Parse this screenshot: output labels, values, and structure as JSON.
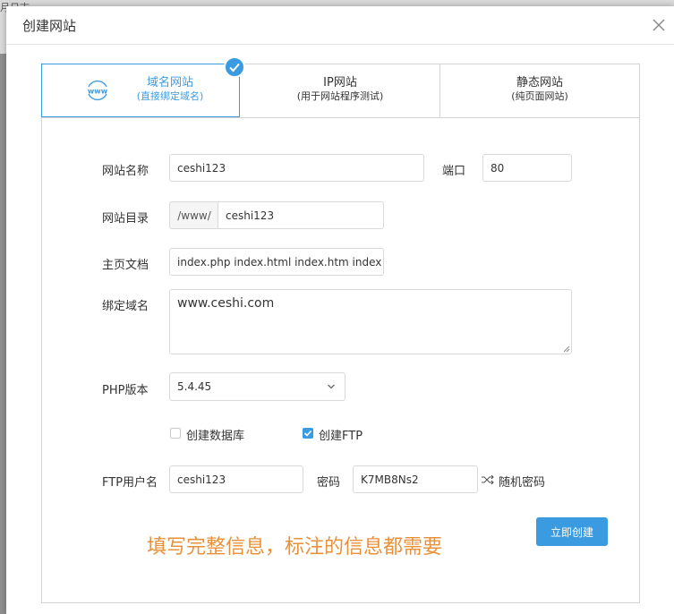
{
  "background": {
    "fragment_text": "月日志"
  },
  "dialog": {
    "title": "创建网站"
  },
  "tabs": [
    {
      "name": "域名网站",
      "sub": "(直接绑定域名)",
      "selected": true
    },
    {
      "name": "IP网站",
      "sub": "(用于网站程序测试)",
      "selected": false
    },
    {
      "name": "静态网站",
      "sub": "(纯页面网站)",
      "selected": false
    }
  ],
  "form": {
    "site_name": {
      "label": "网站名称",
      "value": "ceshi123"
    },
    "port": {
      "label": "端口",
      "value": "80"
    },
    "site_dir": {
      "label": "网站目录",
      "prefix": "/www/",
      "value": "ceshi123"
    },
    "index_doc": {
      "label": "主页文档",
      "value": "index.php index.html index.htm index"
    },
    "bind_domain": {
      "label": "绑定域名",
      "value": "www.ceshi.com"
    },
    "php_version": {
      "label": "PHP版本",
      "value": "5.4.45"
    },
    "create_db": {
      "label": "创建数据库",
      "checked": false
    },
    "create_ftp": {
      "label": "创建FTP",
      "checked": true
    },
    "ftp_user": {
      "label": "FTP用户名",
      "value": "ceshi123"
    },
    "password": {
      "label": "密码",
      "value": "K7MB8Ns2"
    },
    "random_password": {
      "label": "随机密码"
    }
  },
  "notice": "填写完整信息，标注的信息都需要",
  "submit": {
    "label": "立即创建"
  },
  "colors": {
    "accent": "#3b9be0",
    "notice": "#e8913b",
    "border": "#d9d9d9"
  }
}
